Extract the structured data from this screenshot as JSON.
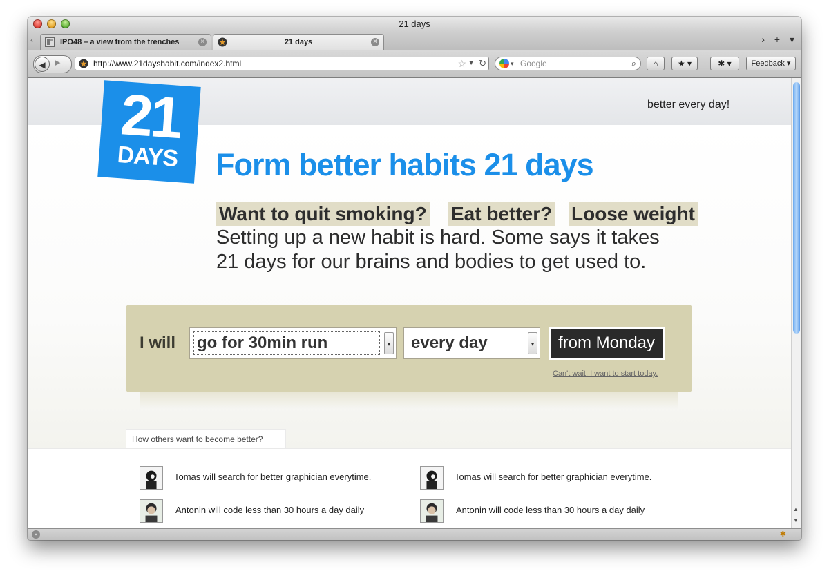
{
  "window": {
    "title": "21 days"
  },
  "tabs": [
    {
      "label": "IPO48 – a view from the trenches",
      "active": false
    },
    {
      "label": "21 days",
      "active": true
    }
  ],
  "toolbar": {
    "url": "http://www.21dayshabit.com/index2.html",
    "search_placeholder": "Google",
    "feedback_label": "Feedback"
  },
  "page": {
    "logo": {
      "number": "21",
      "word": "DAYS"
    },
    "tagline": "better every day!",
    "headline": "Form better habits 21 days",
    "chips": [
      "Want to quit smoking?",
      "Eat better?",
      "Loose weight"
    ],
    "description_line1": "Setting up a new habit is hard. Some says it takes",
    "description_line2": "21 days for our brains and bodies to get used to.",
    "form": {
      "prefix": "I will",
      "activity_selected": "go for 30min run",
      "frequency_selected": "every day",
      "start_button": "from Monday",
      "start_today_link": "Can't wait. I want to start today."
    },
    "others_tab_label": "How others want to become better?",
    "entries": [
      {
        "text": "Tomas will search for better graphician everytime."
      },
      {
        "text": "Tomas will search for better graphician everytime."
      },
      {
        "text": "Antonin will code less than 30 hours a day daily"
      },
      {
        "text": "Antonin will code less than 30 hours a day daily"
      }
    ]
  },
  "colors": {
    "brand_blue": "#1b8fe9",
    "chip_bg": "#e1ddc7",
    "form_panel_bg": "#d6d2b0",
    "start_button_bg": "#2a2a2a"
  },
  "icons": [
    "back-icon",
    "forward-icon",
    "star-icon",
    "reload-icon",
    "search-icon",
    "home-icon",
    "bookmarks-icon",
    "extension-icon",
    "stop-icon"
  ]
}
